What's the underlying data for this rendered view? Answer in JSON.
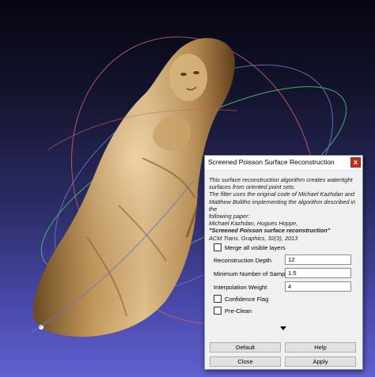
{
  "dialog": {
    "title": "Screened Poisson Surface Reconstruction",
    "close_glyph": "x",
    "description": {
      "line1": "This surface reconstruction algorithm creates watertight",
      "line2": "surfaces from oriented point sets.",
      "line3": "The filter uses the original code of Michael Kazhdan and",
      "line4": "Matthew Bolitho implementing the algorithm described in the",
      "line5": "following paper:",
      "authors": "Michael Kazhdan, Hugues Hoppe,",
      "paper_title": "\"Screened Poisson surface reconstruction\"",
      "journal": "ACM Trans. Graphics, 32(3), 2013"
    },
    "merge_layers_label": "Merge all visible layers",
    "params": [
      {
        "label": "Reconstruction Depth",
        "value": "12"
      },
      {
        "label": "Minimum Number of Samples",
        "value": "1.5"
      },
      {
        "label": "Interpolation Weight",
        "value": "4"
      }
    ],
    "confidence_label": "Confidence Flag",
    "preclean_label": "Pre-Clean",
    "buttons": {
      "default": "Default",
      "help": "Help",
      "close": "Close",
      "apply": "Apply"
    }
  },
  "colors": {
    "trackball_red": "#c86464",
    "trackball_green": "#50c878",
    "trackball_blue": "#6478c8",
    "close_button": "#c42b1c"
  },
  "icons": {
    "close": "close-icon",
    "expand": "chevron-down-icon"
  }
}
